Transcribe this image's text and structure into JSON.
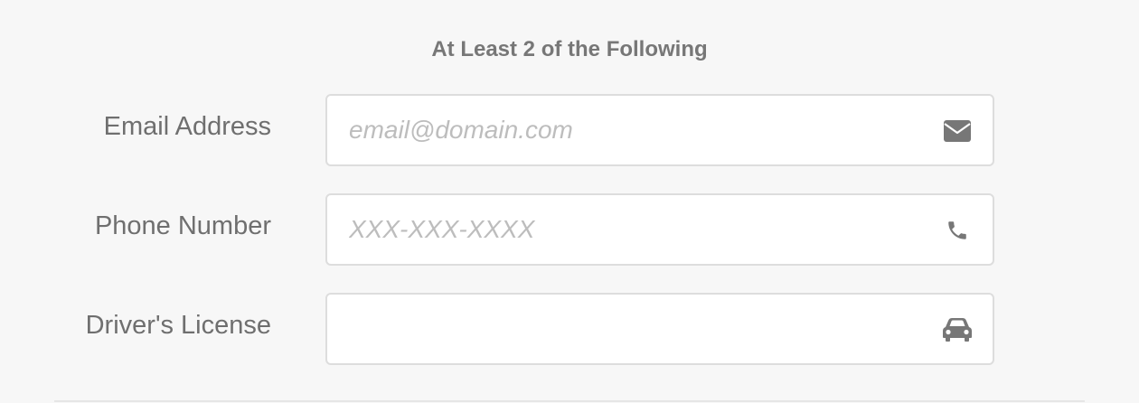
{
  "form": {
    "section_title": "At Least 2 of the Following",
    "fields": {
      "email": {
        "label": "Email Address",
        "placeholder": "email@domain.com",
        "value": "",
        "icon": "envelope-icon"
      },
      "phone": {
        "label": "Phone Number",
        "placeholder": "XXX-XXX-XXXX",
        "value": "",
        "icon": "phone-icon"
      },
      "license": {
        "label": "Driver's License",
        "placeholder": "",
        "value": "",
        "icon": "car-icon"
      }
    }
  },
  "colors": {
    "background": "#f7f7f7",
    "label_text": "#6f6f6f",
    "title_text": "#777777",
    "placeholder_text": "#bdbdbd",
    "input_border": "#dddddd",
    "icon": "#777777"
  }
}
